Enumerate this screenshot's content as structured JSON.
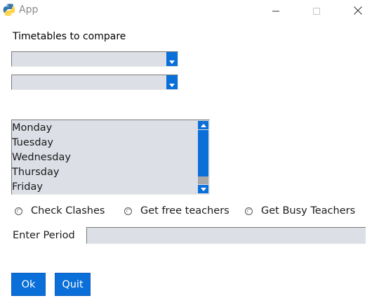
{
  "window": {
    "title": "App",
    "icon": "python-icon",
    "controls": [
      "minimize-icon",
      "maximize-icon",
      "close-icon"
    ]
  },
  "form": {
    "section_label": "Timetables to compare",
    "combo1": {
      "value": ""
    },
    "combo2": {
      "value": ""
    },
    "days": [
      "Monday",
      "Tuesday",
      "Wednesday",
      "Thursday",
      "Friday"
    ],
    "radios": [
      {
        "label": "Check Clashes",
        "selected": false
      },
      {
        "label": "Get free teachers",
        "selected": false
      },
      {
        "label": "Get Busy Teachers",
        "selected": false
      }
    ],
    "period_label": "Enter Period",
    "period_value": ""
  },
  "buttons": {
    "ok": "Ok",
    "quit": "Quit"
  },
  "colors": {
    "accent": "#0a6fd8",
    "field_bg": "#dcdfe6",
    "scroll_track": "#a8a8a8"
  }
}
